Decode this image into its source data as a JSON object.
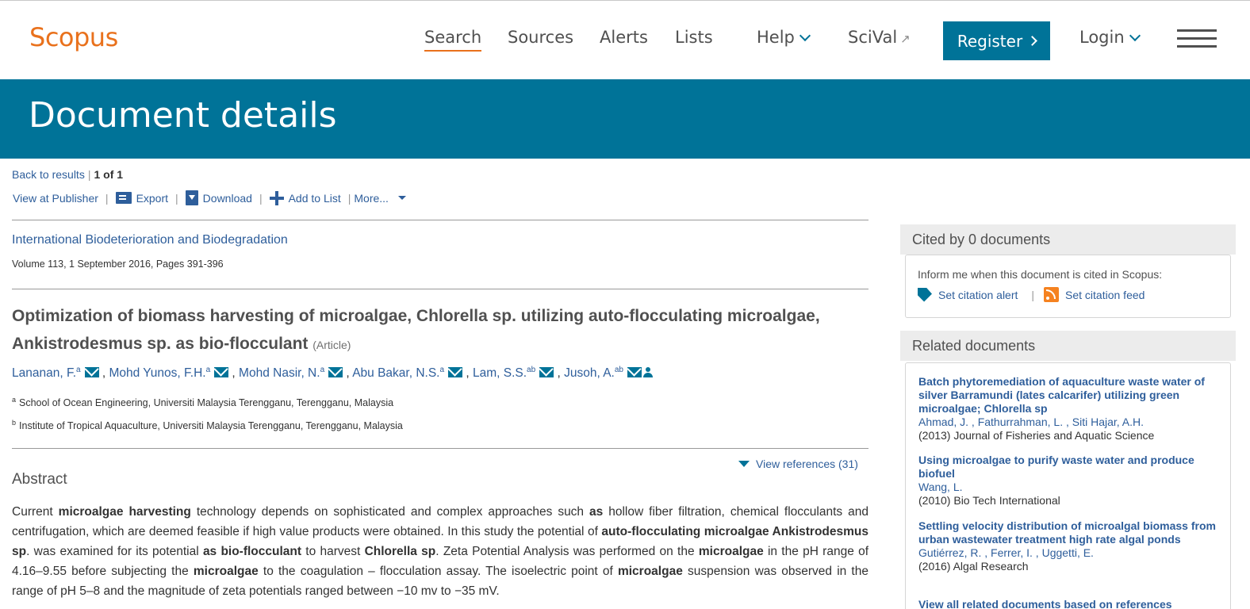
{
  "header": {
    "logo": "Scopus",
    "nav": {
      "search": "Search",
      "sources": "Sources",
      "alerts": "Alerts",
      "lists": "Lists",
      "help": "Help",
      "scival": "SciVal",
      "register": "Register",
      "login": "Login"
    }
  },
  "banner": {
    "title": "Document details"
  },
  "toolbar": {
    "back": "Back to results",
    "count": "1 of 1",
    "view_publisher": "View at Publisher",
    "export": "Export",
    "download": "Download",
    "add_to_list": "Add to List",
    "more": "More..."
  },
  "document": {
    "journal": "International Biodeterioration and Biodegradation",
    "volume": "Volume 113, 1 September 2016, Pages 391-396",
    "title": "Optimization of biomass harvesting of microalgae, Chlorella sp. utilizing auto-flocculating microalgae, Ankistrodesmus sp. as bio-flocculant",
    "type": "(Article)",
    "authors": [
      {
        "name": "Lananan, F.",
        "sup": "a"
      },
      {
        "name": "Mohd Yunos, F.H.",
        "sup": "a"
      },
      {
        "name": "Mohd Nasir, N.",
        "sup": "a"
      },
      {
        "name": "Abu Bakar, N.S.",
        "sup": "a"
      },
      {
        "name": "Lam, S.S.",
        "sup": "ab"
      },
      {
        "name": "Jusoh, A.",
        "sup": "ab"
      }
    ],
    "affiliations": [
      {
        "sup": "a",
        "text": "School of Ocean Engineering, Universiti Malaysia Terengganu, Terengganu, Malaysia"
      },
      {
        "sup": "b",
        "text": "Institute of Tropical Aquaculture, Universiti Malaysia Terengganu, Terengganu, Malaysia"
      }
    ],
    "view_references": "View references (31)",
    "abstract_heading": "Abstract"
  },
  "sidebar": {
    "cited": {
      "heading": "Cited by 0 documents",
      "inform": "Inform me when this document is cited in Scopus:",
      "set_alert": "Set citation alert",
      "set_feed": "Set citation feed"
    },
    "related": {
      "heading": "Related documents",
      "items": [
        {
          "title": "Batch phytoremediation of aquaculture waste water of silver Barramundi (lates calcarifer) utilizing green microalgae; Chlorella sp",
          "authors": "Ahmad, J. , Fathurrahman, L. , Siti Hajar, A.H.",
          "source": "(2013) Journal of Fisheries and Aquatic Science"
        },
        {
          "title": "Using microalgae to purify waste water and produce biofuel",
          "authors": "Wang, L.",
          "source": "(2010) Bio Tech International"
        },
        {
          "title": "Settling velocity distribution of microalgal biomass from urban wastewater treatment high rate algal ponds",
          "authors": "Gutiérrez, R. , Ferrer, I. , Uggetti, E.",
          "source": "(2016) Algal Research"
        }
      ],
      "view_all": "View all related documents based on references"
    }
  }
}
